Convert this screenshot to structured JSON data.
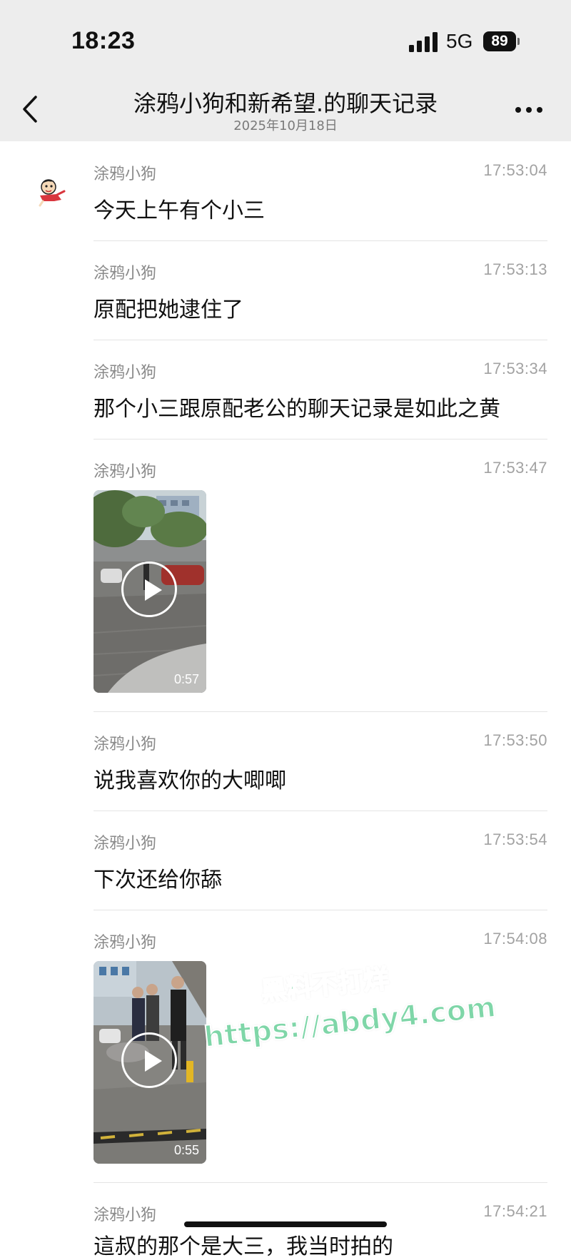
{
  "status_bar": {
    "time": "18:23",
    "network": "5G",
    "battery": "89"
  },
  "header": {
    "title": "涂鸦小狗和新希望.的聊天记录",
    "date": "2025年10月18日"
  },
  "messages": [
    {
      "sender": "涂鸦小狗",
      "time": "17:53:04",
      "type": "text",
      "text": "今天上午有个小三"
    },
    {
      "sender": "涂鸦小狗",
      "time": "17:53:13",
      "type": "text",
      "text": "原配把她逮住了"
    },
    {
      "sender": "涂鸦小狗",
      "time": "17:53:34",
      "type": "text",
      "text": "那个小三跟原配老公的聊天记录是如此之黄"
    },
    {
      "sender": "涂鸦小狗",
      "time": "17:53:47",
      "type": "video",
      "duration": "0:57"
    },
    {
      "sender": "涂鸦小狗",
      "time": "17:53:50",
      "type": "text",
      "text": "说我喜欢你的大唧唧"
    },
    {
      "sender": "涂鸦小狗",
      "time": "17:53:54",
      "type": "text",
      "text": "下次还给你舔"
    },
    {
      "sender": "涂鸦小狗",
      "time": "17:54:08",
      "type": "video",
      "duration": "0:55"
    },
    {
      "sender": "涂鸦小狗",
      "time": "17:54:21",
      "type": "text",
      "text": "這叔的那个是大三，我当时拍的"
    }
  ],
  "watermark": {
    "line1": "黑料不打烊",
    "line2": "https://abdy4.com"
  },
  "icons": {
    "back": "chevron-left-icon",
    "more": "more-horizontal-icon",
    "play": "play-icon"
  },
  "colors": {
    "header_bg": "#ededed",
    "watermark": "#7fd6a8"
  }
}
